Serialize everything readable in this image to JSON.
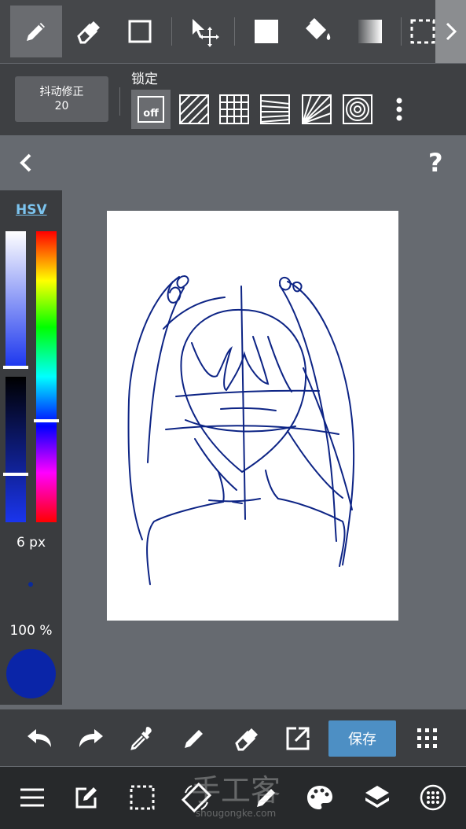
{
  "toolbar": {
    "tools": [
      "pencil-icon",
      "eraser-icon",
      "rectangle-icon",
      "move-icon",
      "fill-square-icon",
      "bucket-icon",
      "gradient-icon",
      "select-icon"
    ],
    "selected": "pencil-icon"
  },
  "stabilizer": {
    "label": "抖动修正",
    "value": "20"
  },
  "lock": {
    "label": "锁定",
    "off": "off"
  },
  "colors": {
    "mode": "HSV",
    "value_level": 0.96,
    "hue_level": 0.65,
    "brightness_level": 0.67,
    "current": "#0a25a8"
  },
  "brush": {
    "size": "6 px",
    "opacity": "100 %"
  },
  "actions": {
    "save": "保存"
  },
  "watermark": {
    "big": "手工客",
    "small": "shougongke.com"
  },
  "accent": "#4d8fc4"
}
